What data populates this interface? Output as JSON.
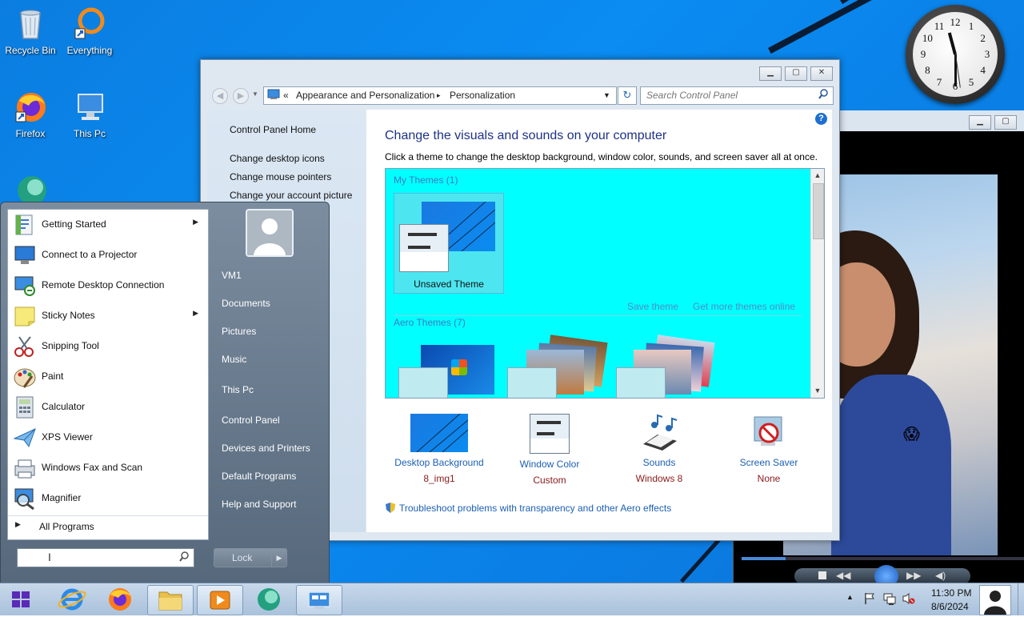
{
  "desktop": {
    "icons": [
      {
        "label": "Recycle Bin"
      },
      {
        "label": "Everything"
      },
      {
        "label": "Firefox"
      },
      {
        "label": "This Pc"
      }
    ]
  },
  "clock": {
    "numbers": [
      "12",
      "1",
      "2",
      "3",
      "4",
      "5",
      "6",
      "7",
      "8",
      "9",
      "10",
      "11"
    ]
  },
  "window": {
    "title_buttons": [
      "minimize",
      "maximize",
      "close"
    ],
    "breadcrumb": {
      "prefix": "«",
      "parent": "Appearance and Personalization",
      "sep": "▸",
      "current": "Personalization"
    },
    "search_placeholder": "Search Control Panel",
    "left_links": [
      "Control Panel Home",
      "Change desktop icons",
      "Change mouse pointers",
      "Change your account picture"
    ],
    "title": "Change the visuals and sounds on your computer",
    "subtitle": "Click a theme to change the desktop background, window color, sounds, and screen saver all at once.",
    "my_themes_header": "My Themes (1)",
    "unsaved_theme": "Unsaved Theme",
    "save_theme": "Save theme",
    "get_more": "Get more themes online",
    "aero_header": "Aero Themes (7)",
    "bottom": [
      {
        "label": "Desktop Background",
        "value": "8_img1"
      },
      {
        "label": "Window Color",
        "value": "Custom"
      },
      {
        "label": "Sounds",
        "value": "Windows 8"
      },
      {
        "label": "Screen Saver",
        "value": "None"
      }
    ],
    "troubleshoot": "Troubleshoot problems with transparency and other Aero effects"
  },
  "start_menu": {
    "programs": [
      {
        "label": "Getting Started",
        "arrow": "▶"
      },
      {
        "label": "Connect to a Projector",
        "arrow": ""
      },
      {
        "label": "Remote Desktop Connection",
        "arrow": ""
      },
      {
        "label": "Sticky Notes",
        "arrow": "▶"
      },
      {
        "label": "Snipping Tool",
        "arrow": ""
      },
      {
        "label": "Paint",
        "arrow": ""
      },
      {
        "label": "Calculator",
        "arrow": ""
      },
      {
        "label": "XPS Viewer",
        "arrow": ""
      },
      {
        "label": "Windows Fax and Scan",
        "arrow": ""
      },
      {
        "label": "Magnifier",
        "arrow": ""
      }
    ],
    "all_programs": "All Programs",
    "right_items": [
      "VM1",
      "Documents",
      "Pictures",
      "Music",
      "This Pc",
      "Control Panel",
      "Devices and Printers",
      "Default Programs",
      "Help and Support"
    ],
    "lock_label": "Lock",
    "lock_arrow": "▶"
  },
  "taskbar": {
    "time": "11:30 PM",
    "date": "8/6/2024",
    "tray_arrow": "▲"
  },
  "video": {
    "emoji": "😱"
  }
}
